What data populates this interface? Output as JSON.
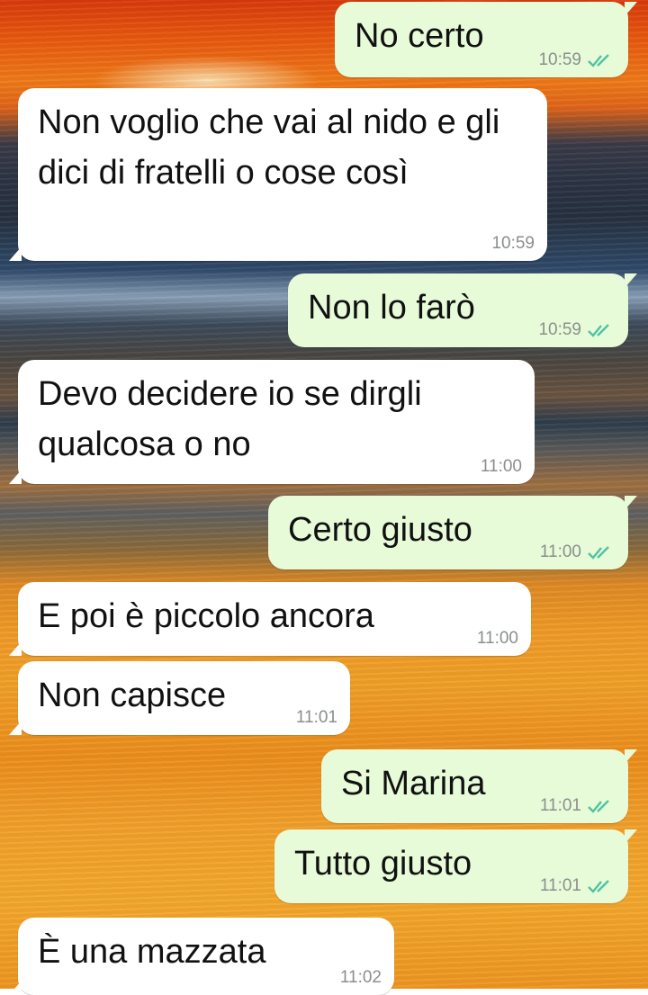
{
  "colors": {
    "outgoing_bubble": "#e7fbd9",
    "incoming_bubble": "#ffffff",
    "read_ticks": "#4fc3a1",
    "timestamp": "#8a8f8c"
  },
  "messages": [
    {
      "direction": "outgoing",
      "text": "No certo",
      "time": "10:59",
      "status_icon": "double-check-icon"
    },
    {
      "direction": "incoming",
      "text": "Non voglio che vai al nido e gli dici di fratelli o cose così",
      "time": "10:59"
    },
    {
      "direction": "outgoing",
      "text": "Non lo farò",
      "time": "10:59",
      "status_icon": "double-check-icon"
    },
    {
      "direction": "incoming",
      "text": "Devo decidere io se dirgli qualcosa o no",
      "time": "11:00"
    },
    {
      "direction": "outgoing",
      "text": "Certo giusto",
      "time": "11:00",
      "status_icon": "double-check-icon"
    },
    {
      "direction": "incoming",
      "text": "E poi è piccolo ancora",
      "time": "11:00"
    },
    {
      "direction": "incoming",
      "text": "Non capisce",
      "time": "11:01"
    },
    {
      "direction": "outgoing",
      "text": "Si Marina",
      "time": "11:01",
      "status_icon": "double-check-icon"
    },
    {
      "direction": "outgoing",
      "text": "Tutto giusto",
      "time": "11:01",
      "status_icon": "double-check-icon"
    },
    {
      "direction": "incoming",
      "text": "È una mazzata",
      "time": "11:02"
    }
  ]
}
